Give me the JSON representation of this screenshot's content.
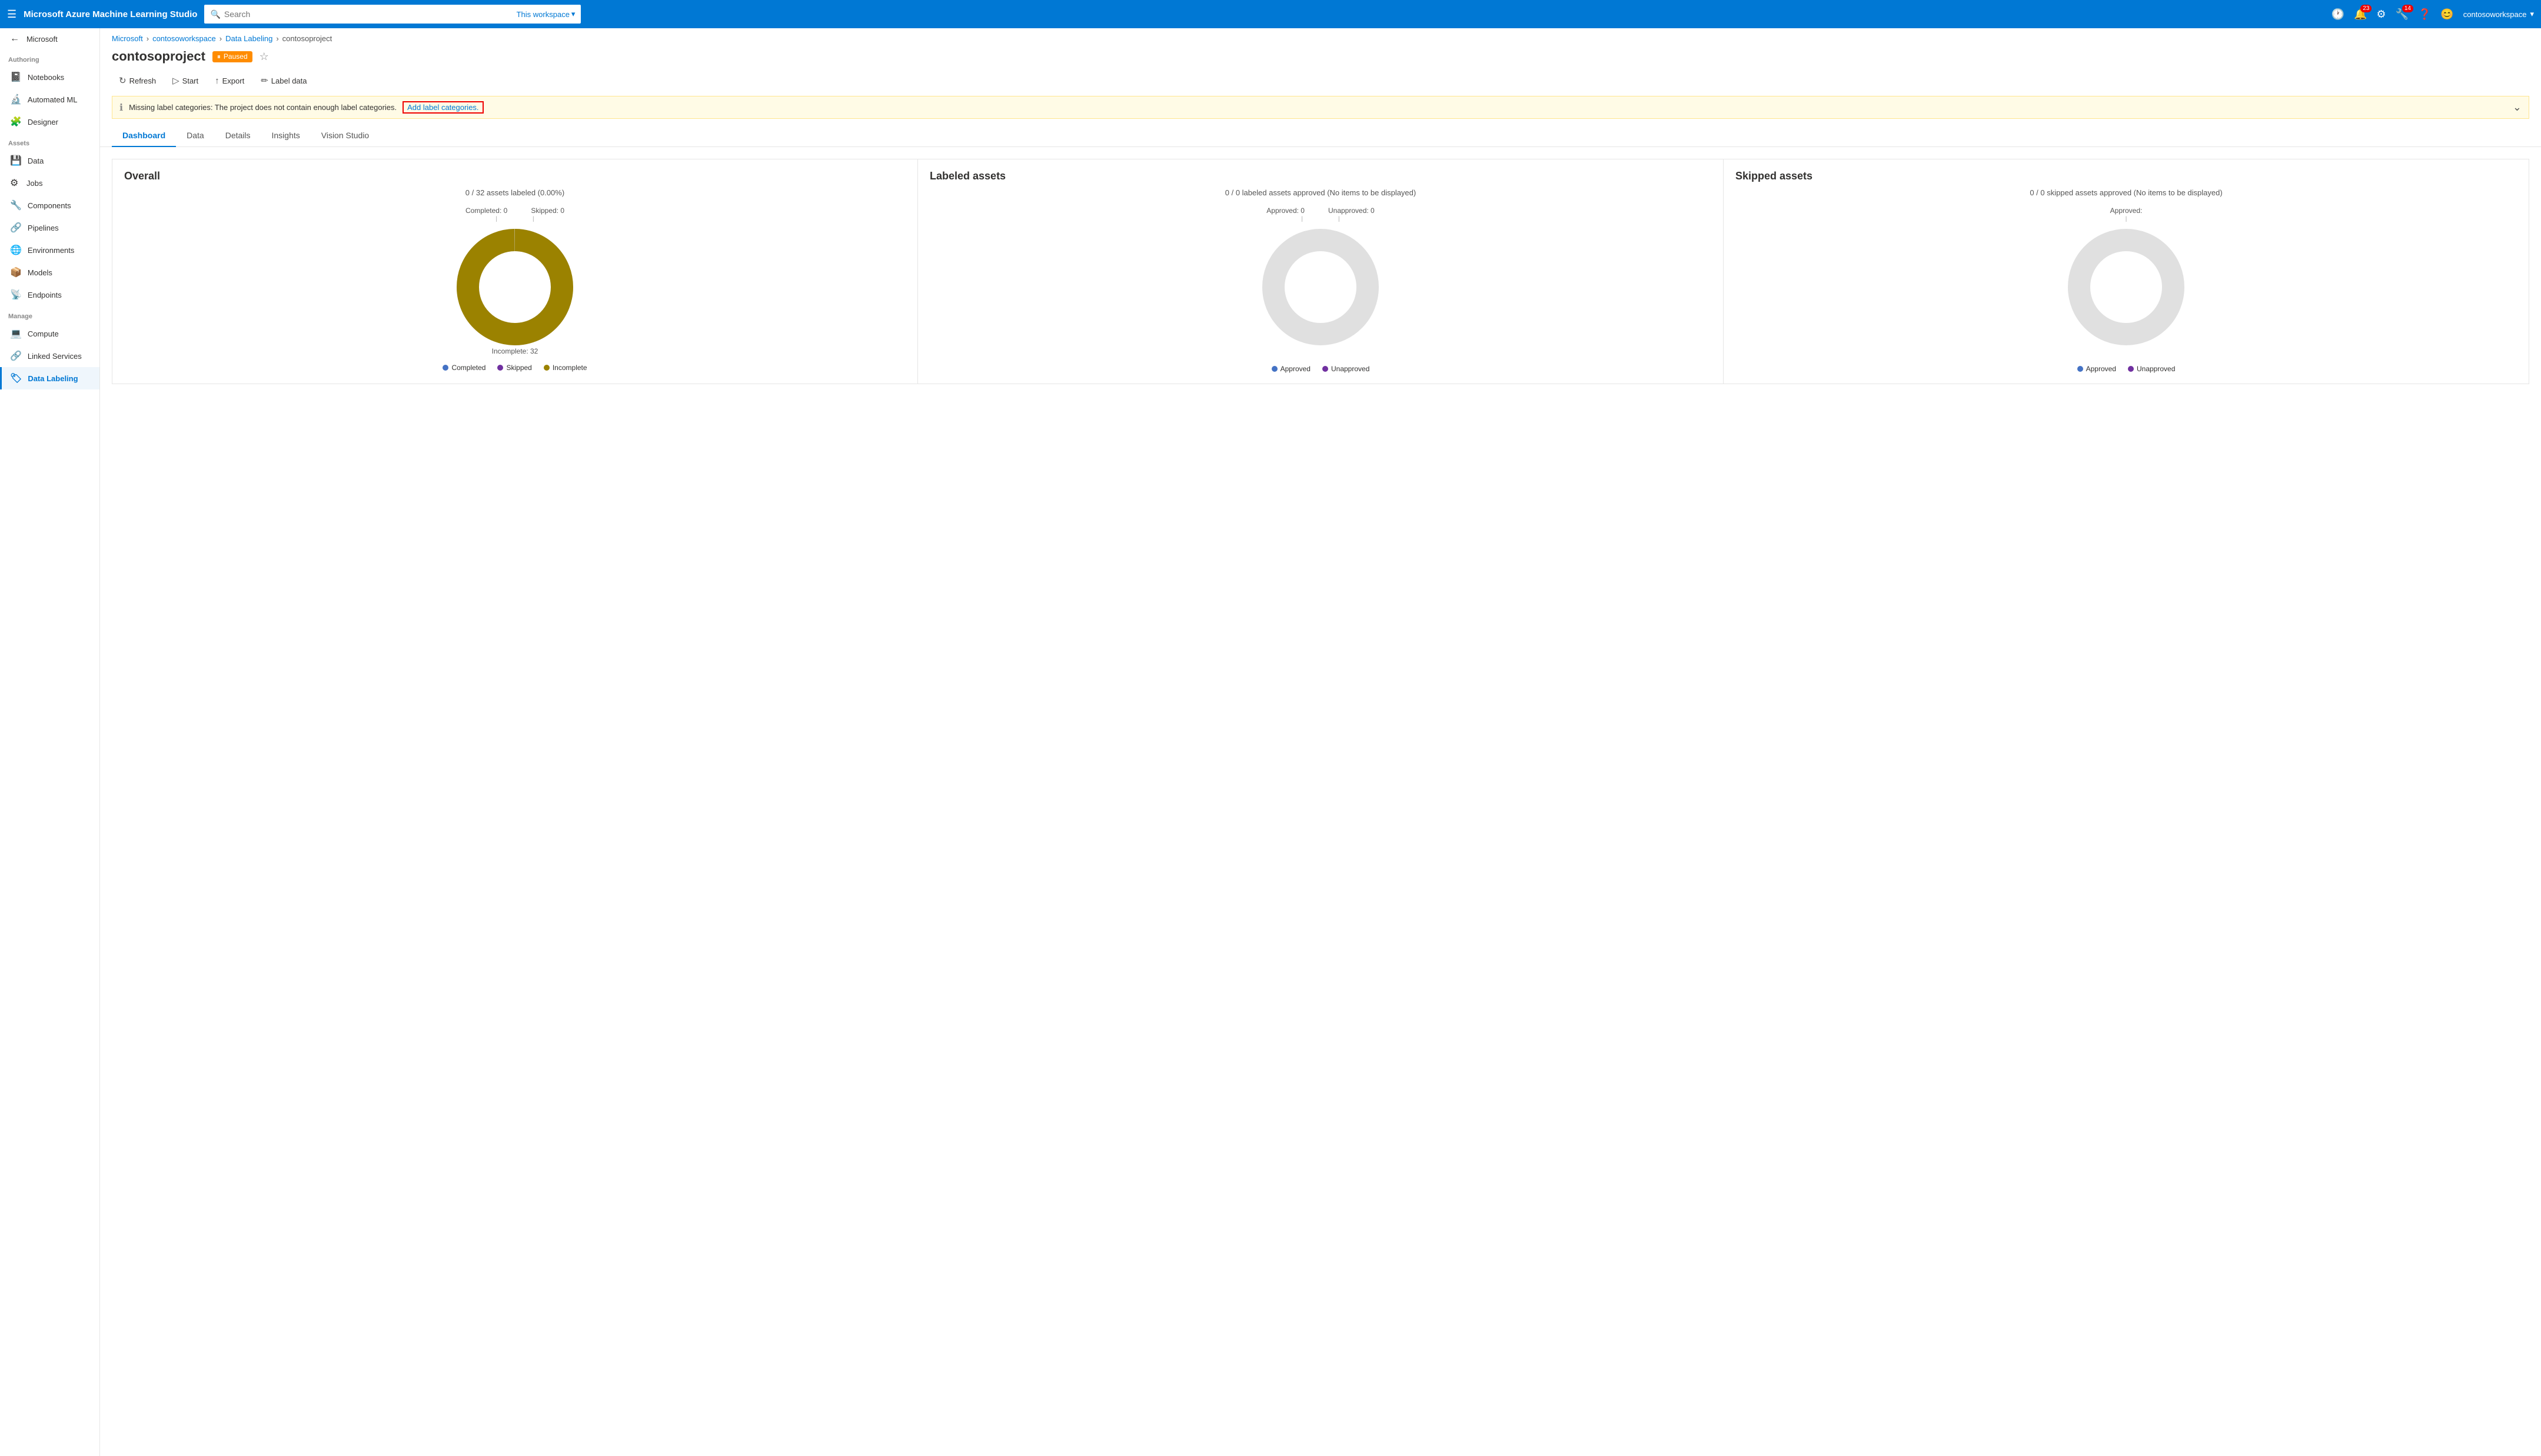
{
  "app": {
    "title": "Microsoft Azure Machine Learning Studio"
  },
  "topnav": {
    "search_placeholder": "Search",
    "search_scope": "This workspace",
    "notifications_count": "23",
    "alerts_count": "14",
    "username": "contosoworkspace"
  },
  "sidebar": {
    "microsoft_label": "Microsoft",
    "hamburger_icon": "☰",
    "sections": [
      {
        "label": "",
        "items": [
          {
            "id": "microsoft",
            "icon": "←",
            "label": "Microsoft"
          }
        ]
      },
      {
        "label": "Authoring",
        "items": [
          {
            "id": "notebooks",
            "icon": "📓",
            "label": "Notebooks"
          },
          {
            "id": "automated-ml",
            "icon": "🔬",
            "label": "Automated ML"
          },
          {
            "id": "designer",
            "icon": "🧩",
            "label": "Designer"
          }
        ]
      },
      {
        "label": "Assets",
        "items": [
          {
            "id": "data",
            "icon": "💾",
            "label": "Data"
          },
          {
            "id": "jobs",
            "icon": "⚙",
            "label": "Jobs"
          },
          {
            "id": "components",
            "icon": "🔧",
            "label": "Components"
          },
          {
            "id": "pipelines",
            "icon": "🔗",
            "label": "Pipelines"
          },
          {
            "id": "environments",
            "icon": "🌐",
            "label": "Environments"
          },
          {
            "id": "models",
            "icon": "📦",
            "label": "Models"
          },
          {
            "id": "endpoints",
            "icon": "📡",
            "label": "Endpoints"
          }
        ]
      },
      {
        "label": "Manage",
        "items": [
          {
            "id": "compute",
            "icon": "💻",
            "label": "Compute"
          },
          {
            "id": "linked-services",
            "icon": "🔗",
            "label": "Linked Services"
          },
          {
            "id": "data-labeling",
            "icon": "🏷",
            "label": "Data Labeling",
            "active": true
          }
        ]
      }
    ]
  },
  "breadcrumb": {
    "items": [
      "Microsoft",
      "contosoworkspace",
      "Data Labeling",
      "contosoproject"
    ]
  },
  "page": {
    "title": "contosoproject",
    "status": "Paused"
  },
  "toolbar": {
    "refresh": "Refresh",
    "start": "Start",
    "export": "Export",
    "label_data": "Label data"
  },
  "warning": {
    "message": "Missing label categories: The project does not contain enough label categories.",
    "link_text": "Add label categories."
  },
  "tabs": {
    "items": [
      "Dashboard",
      "Data",
      "Details",
      "Insights",
      "Vision Studio"
    ],
    "active": "Dashboard"
  },
  "overall_card": {
    "title": "Overall",
    "subtitle": "0 / 32 assets labeled (0.00%)",
    "completed_label": "Completed: 0",
    "skipped_label": "Skipped: 0",
    "incomplete_label": "Incomplete: 32",
    "legend": [
      {
        "label": "Completed",
        "color": "#4472c4"
      },
      {
        "label": "Skipped",
        "color": "#7030a0"
      },
      {
        "label": "Incomplete",
        "color": "#8b7300"
      }
    ],
    "chart": {
      "completed": 0,
      "skipped": 0,
      "incomplete": 32,
      "total": 32,
      "donut_color": "#9b8200"
    }
  },
  "labeled_card": {
    "title": "Labeled assets",
    "subtitle": "0 / 0 labeled assets approved (No items to be displayed)",
    "approved_label": "Approved: 0",
    "unapproved_label": "Unapproved: 0",
    "legend": [
      {
        "label": "Approved",
        "color": "#4472c4"
      },
      {
        "label": "Unapproved",
        "color": "#7030a0"
      }
    ]
  },
  "skipped_card": {
    "title": "Skipped assets",
    "subtitle": "0 / 0 skipped assets approved (No items to be displayed)",
    "approved_label": "Approved:",
    "legend": [
      {
        "label": "Approved",
        "color": "#4472c4"
      },
      {
        "label": "Unappr",
        "color": "#7030a0"
      }
    ]
  }
}
